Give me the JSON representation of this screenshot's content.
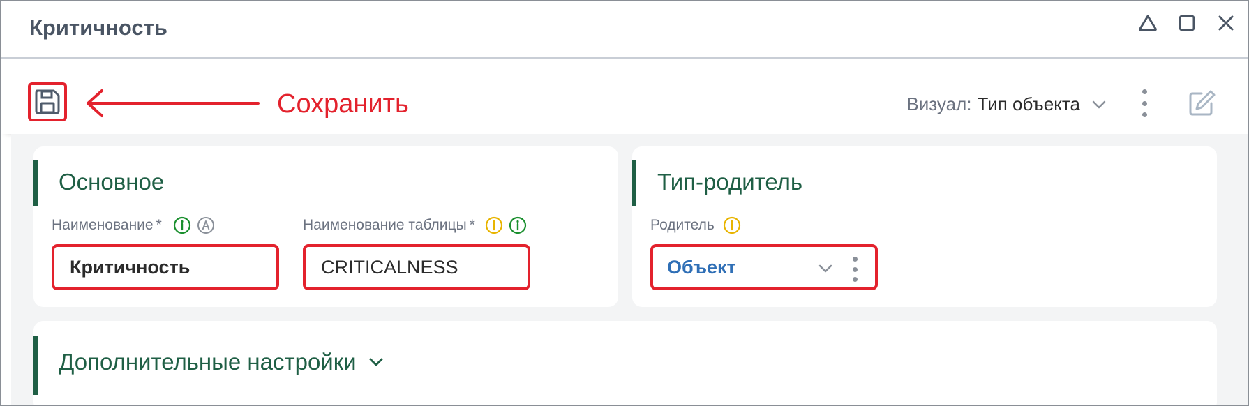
{
  "window": {
    "title": "Критичность"
  },
  "toolbar": {
    "annotation": "Сохранить",
    "visual_label": "Визуал:",
    "visual_value": "Тип объекта"
  },
  "sections": {
    "main": {
      "title": "Основное",
      "name_field": {
        "label": "Наименование",
        "required": "*",
        "value": "Критичность"
      },
      "table_field": {
        "label": "Наименование таблицы",
        "required": "*",
        "value": "CRITICALNESS"
      }
    },
    "parent": {
      "title": "Тип-родитель",
      "parent_field": {
        "label": "Родитель",
        "value": "Объект"
      }
    },
    "extra": {
      "title": "Дополнительные настройки"
    }
  },
  "colors": {
    "accent_green": "#1f5f45",
    "annotation_red": "#e3222d",
    "link_blue": "#2f6fb6",
    "info_green": "#1a8f2e",
    "info_yellow": "#e8b400"
  }
}
